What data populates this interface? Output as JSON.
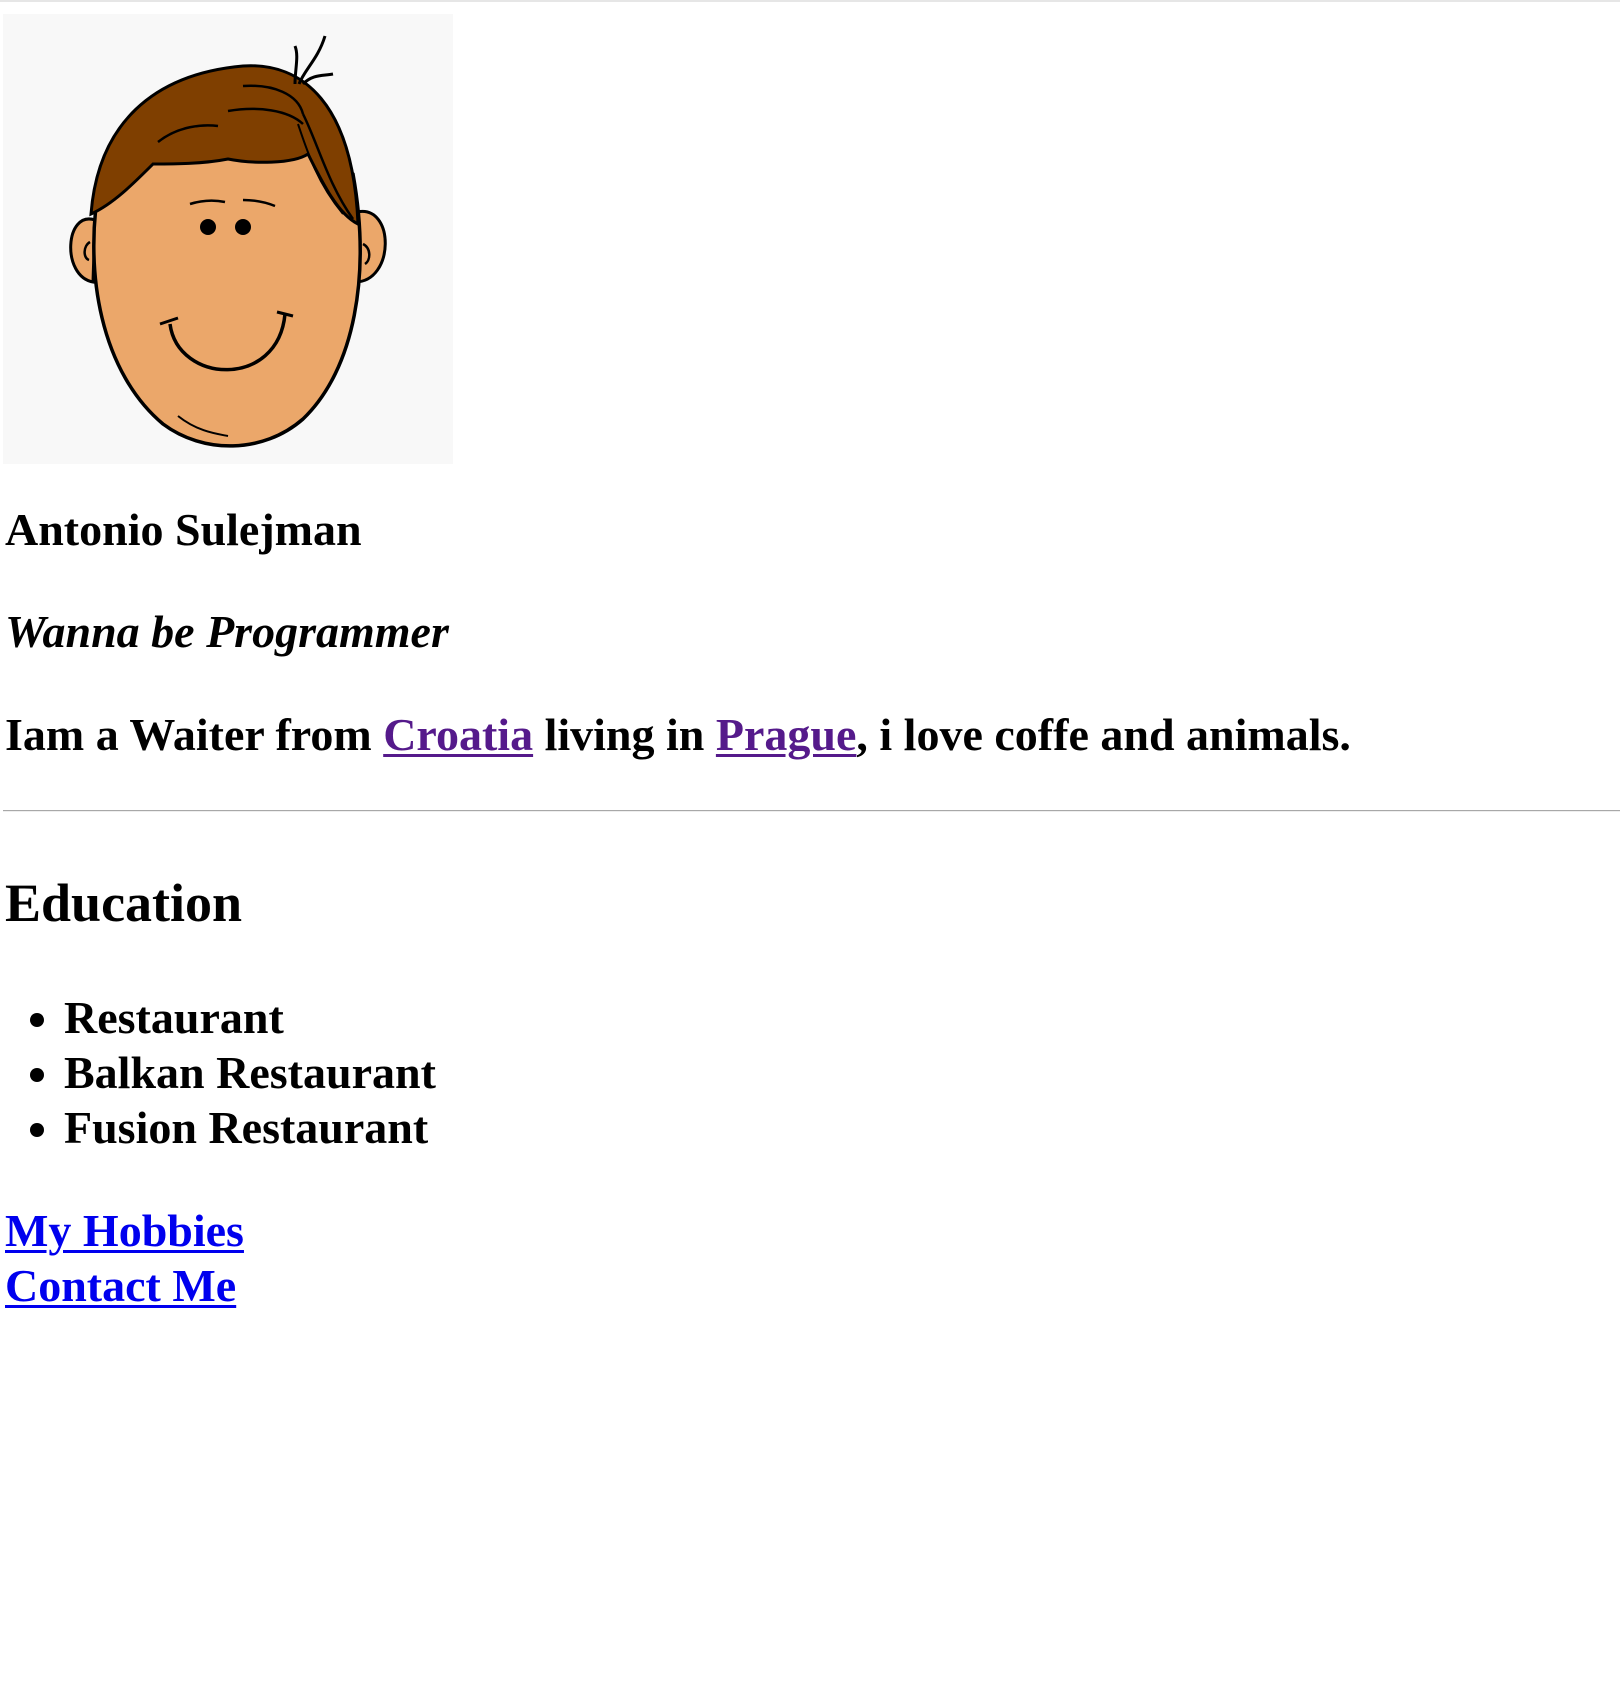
{
  "profile": {
    "avatar_icon": "cartoon-boy-face",
    "name": "Antonio Sulejman",
    "tagline": "Wanna be Programmer"
  },
  "bio": {
    "before": "Iam a Waiter from ",
    "link1": "Croatia",
    "middle": " living in ",
    "link2": "Prague",
    "after": ", i love coffe and animals."
  },
  "education": {
    "heading": "Education",
    "items": [
      "Restaurant",
      "Balkan Restaurant",
      "Fusion Restaurant"
    ]
  },
  "links": {
    "hobbies": "My Hobbies",
    "contact": "Contact Me"
  },
  "colors": {
    "visited_link": "#551a8b",
    "link": "#0000ee",
    "skin": "#eba76a",
    "hair": "#7f3f00",
    "avatar_bg": "#f8f8f8"
  }
}
